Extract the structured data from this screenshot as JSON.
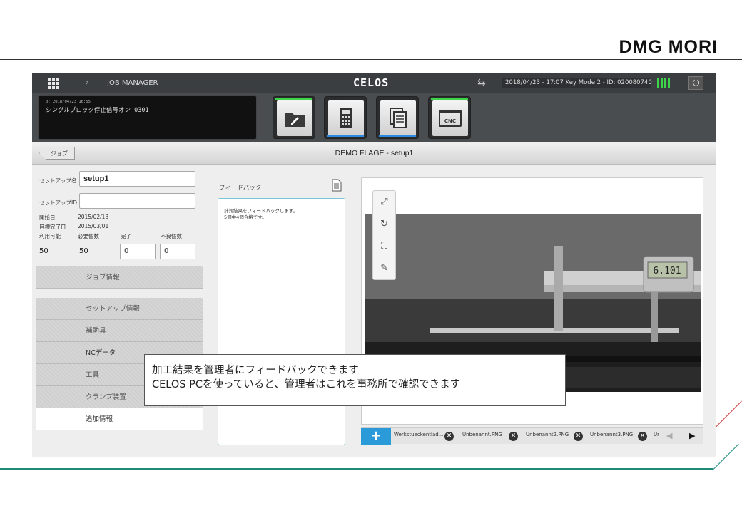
{
  "brand": {
    "logo_text": "DMG MORI"
  },
  "topbar": {
    "app_name": "JOB MANAGER",
    "platform": "CELOS",
    "status": "2018/04/23 - 17:07  Key Mode 2 - ID: 020080740"
  },
  "message_panel": {
    "timestamp": "0: 2018/04/23 16:55",
    "message": "シングルブロック停止信号オン 0301"
  },
  "app_buttons": [
    {
      "icon": "folder-edit-icon",
      "accent": "#3dd44a"
    },
    {
      "icon": "calculator-icon",
      "accent": "#2b8ae0"
    },
    {
      "icon": "documents-icon",
      "accent": "#2b8ae0"
    },
    {
      "icon": "cnc-icon",
      "accent": "#3dd44a",
      "label": "CNC"
    }
  ],
  "subbar": {
    "back_label": "ジョブ",
    "title": "DEMO FLAGE - setup1"
  },
  "setup": {
    "name_label": "セットアップ名",
    "name_value": "setup1",
    "id_label": "セットアップID",
    "id_value": "",
    "start_label": "開始日",
    "start_value": "2015/02/13",
    "target_label": "目標完了日",
    "target_value": "2015/03/01",
    "available_label": "利用可能",
    "required_label": "必要個数",
    "done_label": "完了",
    "defect_label": "不良個数",
    "available_value": "50",
    "required_value": "50",
    "done_value": "0",
    "defect_value": "0"
  },
  "sections": {
    "job_info": "ジョブ情報",
    "setup_info": "セットアップ情報",
    "fixtures": "補助具",
    "nc_data": "NCデータ",
    "tools": "工具",
    "clamping": "クランプ装置",
    "additional": "追加情報"
  },
  "feedback": {
    "label": "フィードバック",
    "line1": "計測結果をフィードバックします。",
    "line2": "5個中4個合格です。"
  },
  "viewer": {
    "caliper_reading": "6.101"
  },
  "tabs": {
    "items": [
      "Werkstueckentlad...",
      "Unbenannt.PNG",
      "Unbenannt2.PNG",
      "Unbenannt3.PNG",
      "Ur"
    ]
  },
  "callout": {
    "line1": "加工結果を管理者にフィードバックできます",
    "line2": "CELOS PCを使っていると、管理者はこれを事務所で確認できます"
  },
  "colors": {
    "accent_green": "#3dd44a",
    "accent_blue": "#2b8ae0",
    "feedback_border": "#7ac6d8",
    "rule_teal": "#1e8a7a",
    "rule_red": "#d23a3a"
  }
}
